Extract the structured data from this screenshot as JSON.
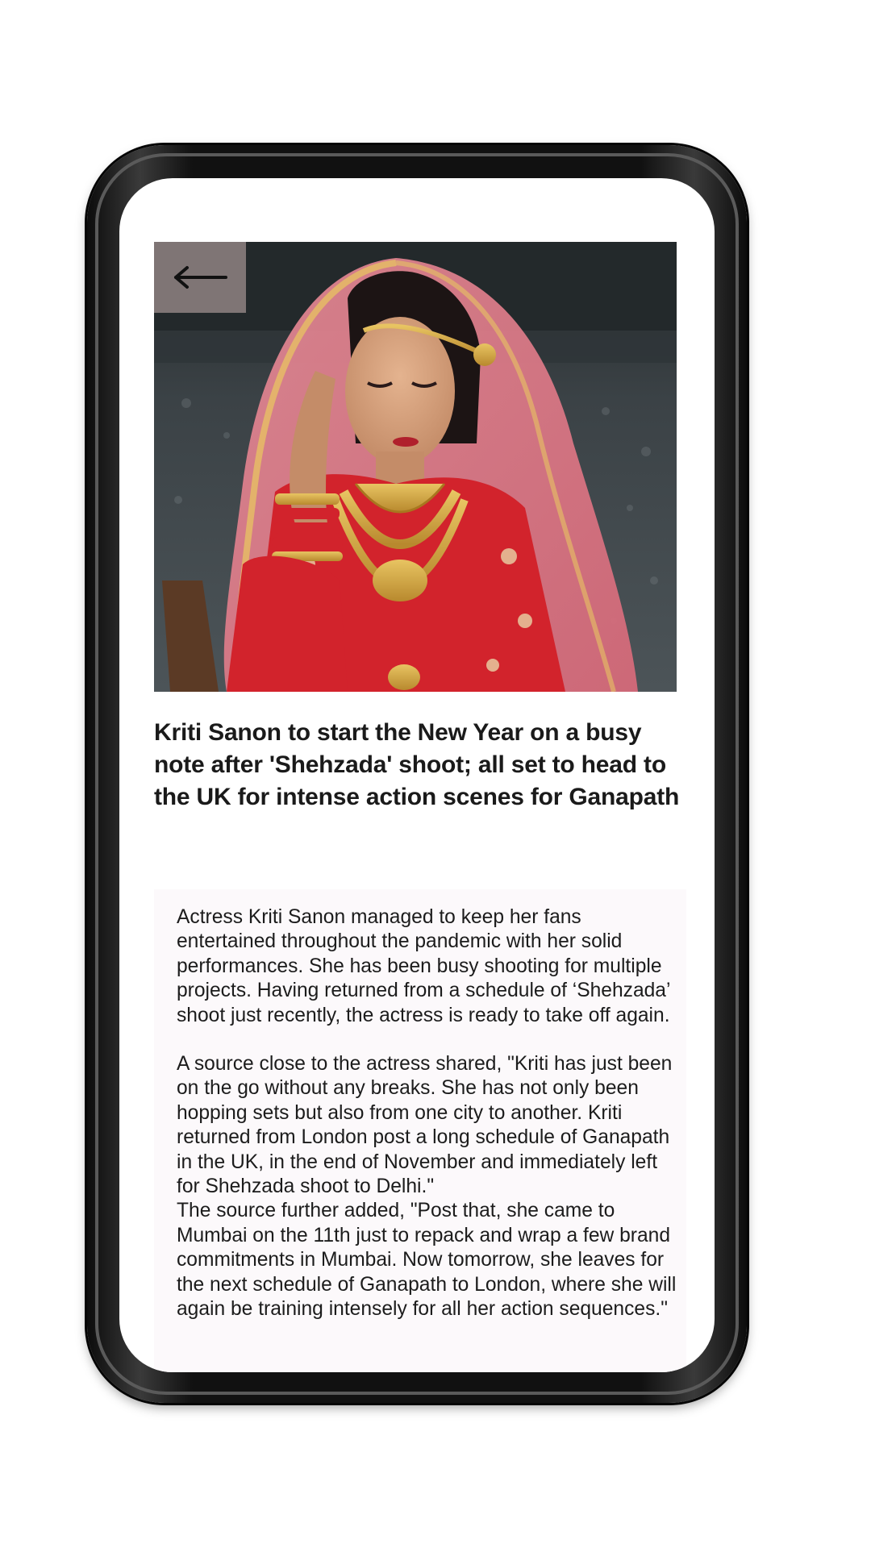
{
  "article": {
    "back_icon": "arrow-left-icon",
    "image_subject": "bride-in-red-lehenga",
    "headline": "Kriti Sanon to start the New Year on a busy note after 'Shehzada' shoot; all set to head to the UK for intense action scenes for Ganapath",
    "paragraphs": [
      "Actress Kriti Sanon managed to keep her fans entertained throughout the pandemic with her solid performances. She has been busy shooting for multiple projects. Having returned from a schedule of ‘Shehzada’ shoot just recently, the actress is ready to take off again.",
      "A source close to the actress shared, \"Kriti has just been on the go without any breaks. She has not only been hopping sets but also from one city to another. Kriti returned from London post a long schedule of Ganapath in the UK, in the end of November and immediately left for Shehzada shoot to Delhi.\"\nThe source further added, \"Post that, she came to Mumbai on the 11th just to repack and wrap a few brand commitments in Mumbai. Now tomorrow, she leaves for the next schedule of Ganapath to London, where she will again be training intensely for all her action sequences.\""
    ]
  },
  "colors": {
    "headline": "#1a1a1a",
    "body_text": "#1c1c1c",
    "body_background": "#fcf9fb",
    "back_button_background": "#8c8080",
    "phone_frame": "#111111"
  }
}
